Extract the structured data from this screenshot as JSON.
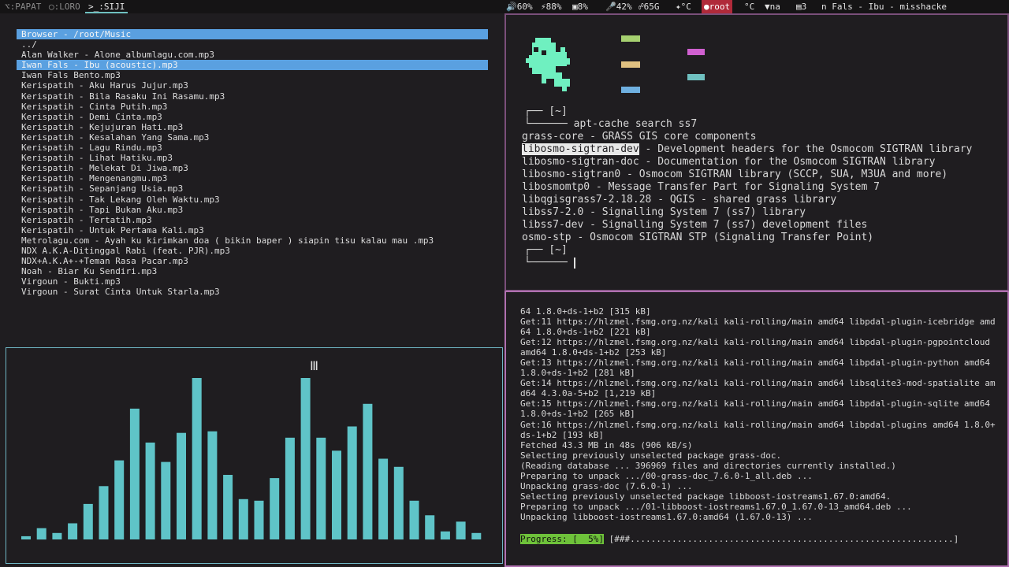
{
  "topbar": {
    "workspaces": [
      {
        "label": "⌥:PAPAT",
        "active": false
      },
      {
        "label": "◯:LORO",
        "active": false
      },
      {
        "label": ">_:SIJI",
        "active": true
      }
    ],
    "status": {
      "volume": "60%",
      "cpu": "88%",
      "disk": "8%",
      "mic": "42%",
      "net": "65G",
      "temp": "°C",
      "user": "root",
      "temp2": "°C",
      "na": "na",
      "tasks": "3",
      "now_playing": "n Fals -  Ibu - misshacke"
    }
  },
  "browser": {
    "title": "Browser - /root/Music",
    "items": [
      {
        "label": "../",
        "highlight": false
      },
      {
        "label": "Alan Walker - Alone_albumlagu.com.mp3",
        "highlight": false
      },
      {
        "label": "Iwan Fals - Ibu (acoustic).mp3",
        "highlight": true
      },
      {
        "label": "Iwan Fals Bento.mp3",
        "highlight": false
      },
      {
        "label": "Kerispatih - Aku Harus Jujur.mp3",
        "highlight": false
      },
      {
        "label": "Kerispatih - Bila Rasaku Ini Rasamu.mp3",
        "highlight": false
      },
      {
        "label": "Kerispatih - Cinta Putih.mp3",
        "highlight": false
      },
      {
        "label": "Kerispatih - Demi Cinta.mp3",
        "highlight": false
      },
      {
        "label": "Kerispatih - Kejujuran Hati.mp3",
        "highlight": false
      },
      {
        "label": "Kerispatih - Kesalahan Yang Sama.mp3",
        "highlight": false
      },
      {
        "label": "Kerispatih - Lagu Rindu.mp3",
        "highlight": false
      },
      {
        "label": "Kerispatih - Lihat Hatiku.mp3",
        "highlight": false
      },
      {
        "label": "Kerispatih - Melekat Di Jiwa.mp3",
        "highlight": false
      },
      {
        "label": "Kerispatih - Mengenangmu.mp3",
        "highlight": false
      },
      {
        "label": "Kerispatih - Sepanjang Usia.mp3",
        "highlight": false
      },
      {
        "label": "Kerispatih - Tak Lekang Oleh Waktu.mp3",
        "highlight": false
      },
      {
        "label": "Kerispatih - Tapi Bukan Aku.mp3",
        "highlight": false
      },
      {
        "label": "Kerispatih - Tertatih.mp3",
        "highlight": false
      },
      {
        "label": "Kerispatih - Untuk Pertama Kali.mp3",
        "highlight": false
      },
      {
        "label": "Metrolagu.com - Ayah ku kirimkan doa ( bikin baper ) siapin tisu kalau mau .mp3",
        "highlight": false
      },
      {
        "label": "NDX A.K.A-Ditinggal Rabi (feat. PJR).mp3",
        "highlight": false
      },
      {
        "label": "NDX+A.K.A+-+Teman Rasa Pacar.mp3",
        "highlight": false
      },
      {
        "label": "Noah - Biar Ku Sendiri.mp3",
        "highlight": false
      },
      {
        "label": "Virgoun - Bukti.mp3",
        "highlight": false
      },
      {
        "label": "Virgoun - Surat Cinta Untuk Starla.mp3",
        "highlight": false
      }
    ]
  },
  "visualizer": {
    "bar_color": "#5fc4c8",
    "levels": [
      0.02,
      0.07,
      0.04,
      0.1,
      0.22,
      0.33,
      0.49,
      0.81,
      0.6,
      0.48,
      0.66,
      1.0,
      0.67,
      0.4,
      0.25,
      0.24,
      0.38,
      0.63,
      1.0,
      0.63,
      0.55,
      0.7,
      0.84,
      0.5,
      0.45,
      0.24,
      0.15,
      0.05,
      0.11,
      0.04
    ]
  },
  "term1": {
    "palette": [
      "#6ff0c0",
      "#a6d070",
      "#e0c080",
      "#6fb0e0",
      "#d060d0",
      "#6fc0c0"
    ],
    "prompt_dir": "[~]",
    "command": "apt-cache search ss7",
    "results": [
      {
        "name": "grass-core",
        "desc": " - GRASS GIS core components",
        "selected": false
      },
      {
        "name": "libosmo-sigtran-dev",
        "desc": " - Development headers for the Osmocom SIGTRAN library",
        "selected": true
      },
      {
        "name": "libosmo-sigtran-doc",
        "desc": " - Documentation for the Osmocom SIGTRAN library",
        "selected": false
      },
      {
        "name": "libosmo-sigtran0",
        "desc": " - Osmocom SIGTRAN library (SCCP, SUA, M3UA and more)",
        "selected": false
      },
      {
        "name": "libosmomtp0",
        "desc": " - Message Transfer Part for Signaling System 7",
        "selected": false
      },
      {
        "name": "libqgisgrass7-2.18.28",
        "desc": " - QGIS - shared grass library",
        "selected": false
      },
      {
        "name": "libss7-2.0",
        "desc": " - Signalling System 7 (ss7) library",
        "selected": false
      },
      {
        "name": "libss7-dev",
        "desc": " - Signalling System 7 (ss7) development files",
        "selected": false
      },
      {
        "name": "osmo-stp",
        "desc": " - Osmocom SIGTRAN STP (Signaling Transfer Point)",
        "selected": false
      }
    ],
    "prompt2_dir": "[~]"
  },
  "term2": {
    "lines": [
      "64 1.8.0+ds-1+b2 [315 kB]",
      "Get:11 https://hlzmel.fsmg.org.nz/kali kali-rolling/main amd64 libpdal-plugin-icebridge amd",
      "64 1.8.0+ds-1+b2 [221 kB]",
      "Get:12 https://hlzmel.fsmg.org.nz/kali kali-rolling/main amd64 libpdal-plugin-pgpointcloud",
      "amd64 1.8.0+ds-1+b2 [253 kB]",
      "Get:13 https://hlzmel.fsmg.org.nz/kali kali-rolling/main amd64 libpdal-plugin-python amd64",
      "1.8.0+ds-1+b2 [281 kB]",
      "Get:14 https://hlzmel.fsmg.org.nz/kali kali-rolling/main amd64 libsqlite3-mod-spatialite am",
      "d64 4.3.0a-5+b2 [1,219 kB]",
      "Get:15 https://hlzmel.fsmg.org.nz/kali kali-rolling/main amd64 libpdal-plugin-sqlite amd64",
      "1.8.0+ds-1+b2 [265 kB]",
      "Get:16 https://hlzmel.fsmg.org.nz/kali kali-rolling/main amd64 libpdal-plugins amd64 1.8.0+",
      "ds-1+b2 [193 kB]",
      "Fetched 43.3 MB in 48s (906 kB/s)",
      "Selecting previously unselected package grass-doc.",
      "(Reading database ... 396969 files and directories currently installed.)",
      "Preparing to unpack .../00-grass-doc_7.6.0-1_all.deb ...",
      "Unpacking grass-doc (7.6.0-1) ...",
      "Selecting previously unselected package libboost-iostreams1.67.0:amd64.",
      "Preparing to unpack .../01-libboost-iostreams1.67.0_1.67.0-13_amd64.deb ...",
      "Unpacking libboost-iostreams1.67.0:amd64 (1.67.0-13) ..."
    ],
    "progress_label": "Progress: [  5%]",
    "progress_bar": " [###..............................................................]"
  }
}
